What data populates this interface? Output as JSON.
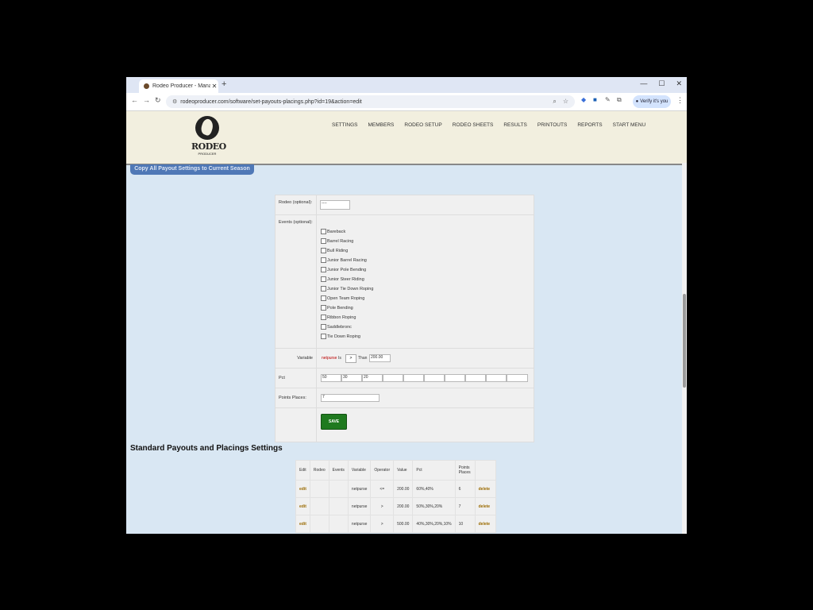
{
  "browser": {
    "tab_title": "Rodeo Producer - Manage Pay",
    "url": "rodeoproducer.com/software/set-payouts-placings.php?id=19&action=edit",
    "verify_label": "Verify it's you"
  },
  "site": {
    "logo_word": "RODEO",
    "logo_sub": "PRODUCER",
    "nav": [
      "SETTINGS",
      "MEMBERS",
      "RODEO SETUP",
      "RODEO SHEETS",
      "RESULTS",
      "PRINTOUTS",
      "REPORTS",
      "START MENU"
    ]
  },
  "copy_button": "Copy All Payout Settings to Current Season",
  "form": {
    "rodeo_label": "Rodeo (optional):",
    "rodeo_value": "----",
    "events_label": "Events (optional):",
    "events": [
      "Bareback",
      "Barrel Racing",
      "Bull Riding",
      "Junior Barrel Racing",
      "Junior Pole Bending",
      "Junior Steer Riding",
      "Junior Tie Down Roping",
      "Open Team Roping",
      "Pole Bending",
      "Ribbon Roping",
      "Saddlebronc",
      "Tie Down Roping"
    ],
    "variable_label": "Variable",
    "variable_value": "netpurse",
    "is_text": "Is",
    "operator": ">",
    "than_text": "Than",
    "than_value": "200.00",
    "pct_label": "Pct",
    "pct_values": [
      "50",
      "30",
      "20",
      "",
      "",
      "",
      "",
      "",
      "",
      ""
    ],
    "points_label": "Points Places:",
    "points_value": "7",
    "save_label": "SAVE"
  },
  "section_title": "Standard Payouts and Placings Settings",
  "table": {
    "headers": [
      "Edit",
      "Rodeo",
      "Events",
      "Variable",
      "Operator",
      "Value",
      "Pct",
      "Points Places",
      ""
    ],
    "rows": [
      [
        "edit",
        "",
        "",
        "netpurse",
        "<=",
        "200.00",
        "60%,40%",
        "6",
        "delete"
      ],
      [
        "edit",
        "",
        "",
        "netpurse",
        ">",
        "200.00",
        "50%,30%,20%",
        "7",
        "delete"
      ],
      [
        "edit",
        "",
        "",
        "netpurse",
        ">",
        "500.00",
        "40%,30%,20%,10%",
        "10",
        "delete"
      ]
    ]
  }
}
